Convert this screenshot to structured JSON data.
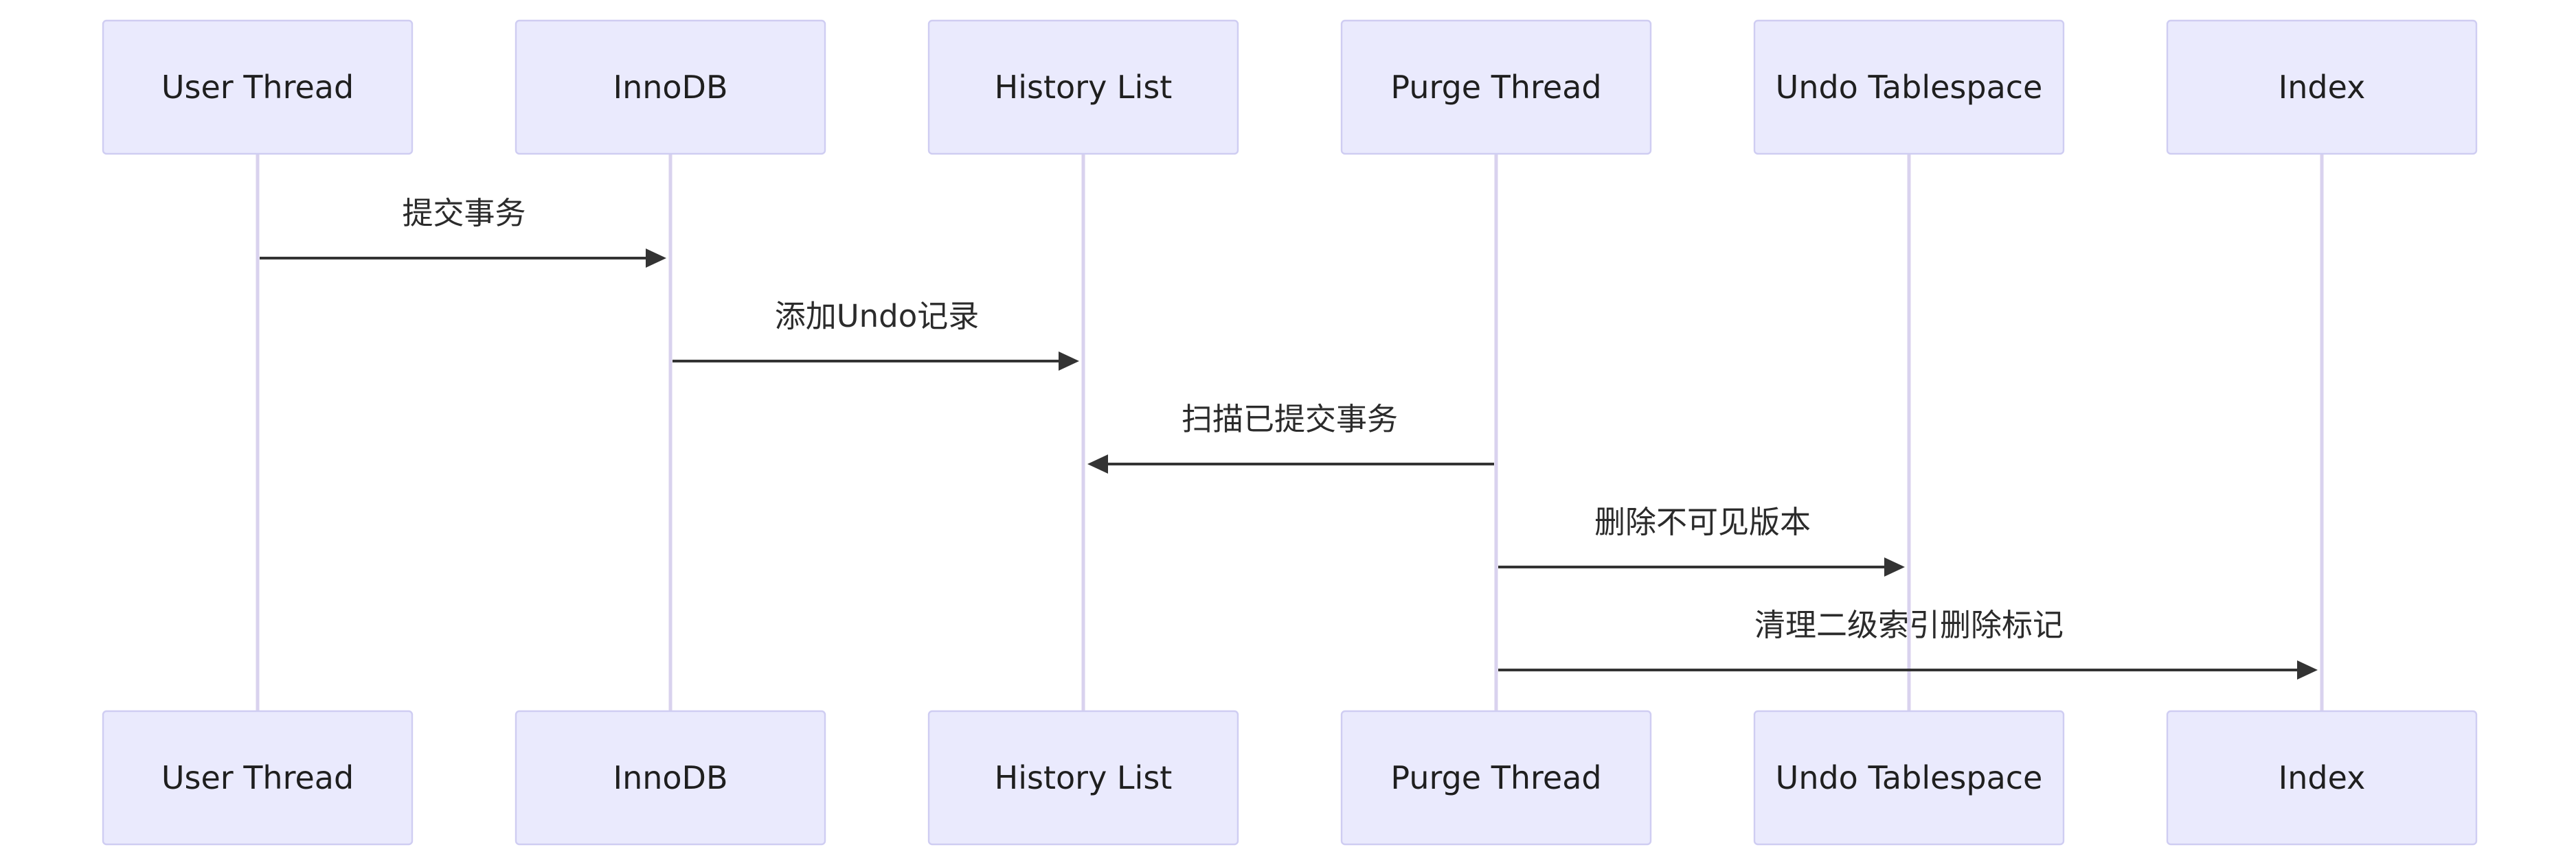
{
  "diagram": {
    "type": "sequence",
    "participants": [
      {
        "id": "user",
        "label": "User Thread"
      },
      {
        "id": "innodb",
        "label": "InnoDB"
      },
      {
        "id": "history",
        "label": "History List"
      },
      {
        "id": "purge",
        "label": "Purge Thread"
      },
      {
        "id": "undo",
        "label": "Undo Tablespace"
      },
      {
        "id": "index",
        "label": "Index"
      }
    ],
    "messages": [
      {
        "from": "user",
        "to": "innodb",
        "label": "提交事务"
      },
      {
        "from": "innodb",
        "to": "history",
        "label": "添加Undo记录"
      },
      {
        "from": "purge",
        "to": "history",
        "label": "扫描已提交事务"
      },
      {
        "from": "purge",
        "to": "undo",
        "label": "删除不可见版本"
      },
      {
        "from": "purge",
        "to": "index",
        "label": "清理二级索引删除标记"
      }
    ],
    "colors": {
      "actor_fill": "#eaeafd",
      "actor_border": "#cfcdf2",
      "lifeline": "#d9d2ee",
      "message": "#333333",
      "text": "#1f1f1f"
    }
  }
}
